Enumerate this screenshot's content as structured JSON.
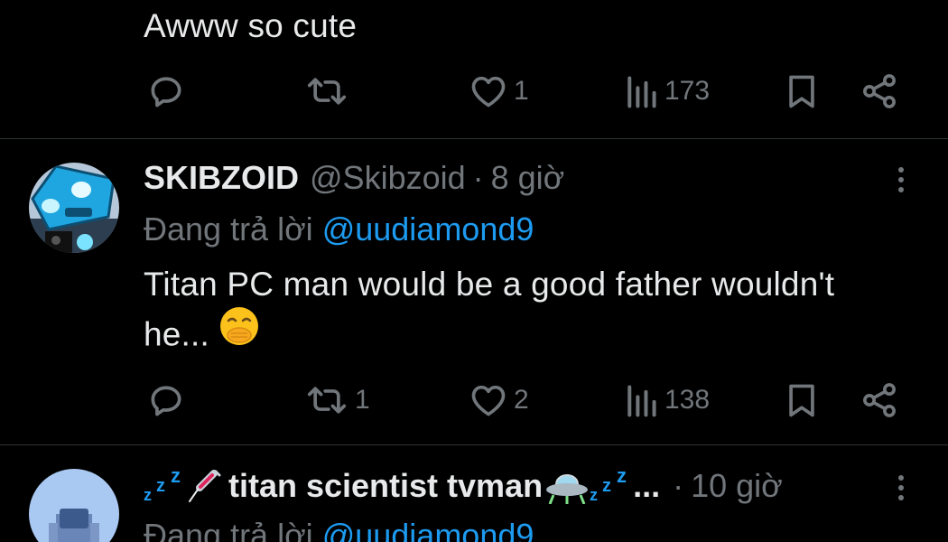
{
  "tweets": [
    {
      "body": "Awww so cute",
      "stats": {
        "replies": "",
        "reposts": "",
        "likes": "1",
        "views": "173"
      }
    },
    {
      "display_name": "SKIBZOID",
      "handle": "@Skibzoid",
      "separator": "·",
      "time": "8 giờ",
      "reply_prefix": "Đang trả lời",
      "reply_to": "@uudiamond9",
      "body_line1": "Titan PC man would be a good father wouldn't",
      "body_line2": "he...",
      "emoji": "hand-over-mouth-emoji",
      "stats": {
        "replies": "",
        "reposts": "1",
        "likes": "2",
        "views": "138"
      }
    },
    {
      "display_name": "titan scientist tvman",
      "name_ellipsis": "...",
      "separator": "·",
      "time": "10 giờ",
      "reply_prefix": "Đang trả lời",
      "reply_to": "@uudiamond9"
    }
  ],
  "colors": {
    "background": "#000000",
    "text": "#e7e9ea",
    "muted": "#71767b",
    "link": "#1d9bf0",
    "divider": "#2f3336"
  },
  "icons": [
    "reply-icon",
    "repost-icon",
    "like-icon",
    "views-icon",
    "bookmark-icon",
    "share-icon",
    "more-icon"
  ]
}
